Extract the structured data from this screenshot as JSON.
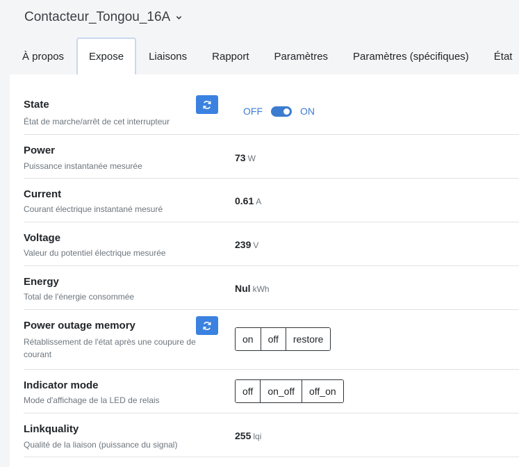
{
  "device": {
    "title": "Contacteur_Tongou_16A"
  },
  "tabs": [
    {
      "label": "À propos"
    },
    {
      "label": "Expose"
    },
    {
      "label": "Liaisons"
    },
    {
      "label": "Rapport"
    },
    {
      "label": "Paramètres"
    },
    {
      "label": "Paramètres (spécifiques)"
    },
    {
      "label": "État"
    }
  ],
  "active_tab": "Expose",
  "colors": {
    "accent": "#3b82e0",
    "toggle": "#3b7cd0",
    "muted": "#6c757d"
  },
  "exposes": {
    "state": {
      "name": "State",
      "description": "État de marche/arrêt de cet interrupteur",
      "off_label": "OFF",
      "on_label": "ON",
      "value": "ON"
    },
    "power": {
      "name": "Power",
      "description": "Puissance instantanée mesurée",
      "value": "73",
      "unit": "W"
    },
    "current": {
      "name": "Current",
      "description": "Courant électrique instantané mesuré",
      "value": "0.61",
      "unit": "A"
    },
    "voltage": {
      "name": "Voltage",
      "description": "Valeur du potentiel électrique mesurée",
      "value": "239",
      "unit": "V"
    },
    "energy": {
      "name": "Energy",
      "description": "Total de l'énergie consommée",
      "value": "Nul",
      "unit": "kWh"
    },
    "power_outage_memory": {
      "name": "Power outage memory",
      "description": "Rétablissement de l'état après une coupure de courant",
      "options": [
        "on",
        "off",
        "restore"
      ]
    },
    "indicator_mode": {
      "name": "Indicator mode",
      "description": "Mode d'affichage de la LED de relais",
      "options": [
        "off",
        "on_off",
        "off_on"
      ]
    },
    "linkquality": {
      "name": "Linkquality",
      "description": "Qualité de la liaison (puissance du signal)",
      "value": "255",
      "unit": "lqi"
    }
  }
}
